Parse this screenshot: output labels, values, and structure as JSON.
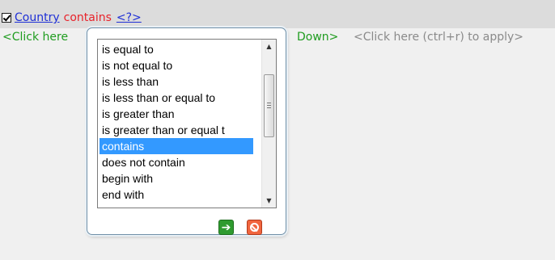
{
  "filter": {
    "field": "Country",
    "operator": "contains",
    "value": "<?>",
    "checked": true
  },
  "hints": {
    "left": "<Click here",
    "mid": "Down>",
    "right": "<Click here (ctrl+r) to apply>"
  },
  "operator_list": {
    "options": [
      "is equal to",
      "is not equal to",
      "is less than",
      "is less than or equal to",
      "is greater than",
      "is greater than or equal t",
      "contains",
      "does not contain",
      "begin with",
      "end with"
    ],
    "selected": "contains"
  },
  "buttons": {
    "apply_icon": "apply-arrow-icon",
    "cancel_icon": "cancel-icon"
  },
  "colors": {
    "field_link": "#1e2fd6",
    "operator": "#e8222a",
    "hint_green": "#1f9c1f",
    "hint_gray": "#8a8a8a",
    "selection": "#3399ff",
    "apply": "#2f9b2f",
    "cancel": "#f1653e"
  }
}
